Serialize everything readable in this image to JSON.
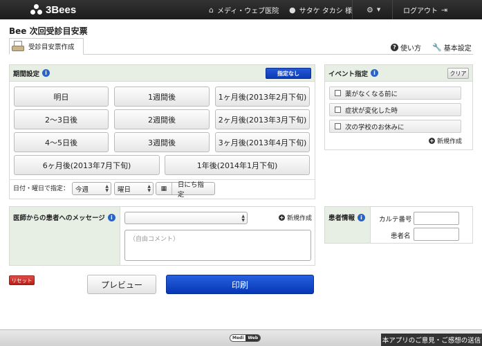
{
  "brand": {
    "name": "3Bees"
  },
  "topnav": {
    "clinic": "メディ・ウェブ医院",
    "user": "サタケ タカシ 様",
    "logout": "ログアウト"
  },
  "page": {
    "title": "Bee 次回受診目安票"
  },
  "tabs": [
    {
      "label": "受診目安票作成"
    }
  ],
  "header_links": {
    "help": "使い方",
    "settings": "基本設定"
  },
  "period": {
    "title": "期間設定",
    "none_button": "指定なし",
    "buttons": [
      "明日",
      "1週間後",
      "1ヶ月後(2013年2月下旬)",
      "2〜3日後",
      "2週間後",
      "2ヶ月後(2013年3月下旬)",
      "4〜5日後",
      "3週間後",
      "3ヶ月後(2013年4月下旬)",
      "6ヶ月後(2013年7月下旬)",
      "1年後(2014年1月下旬)"
    ],
    "date_label": "日付・曜日で指定：",
    "week_select": "今週",
    "day_select": "曜日",
    "date_button": "日にち指定"
  },
  "events": {
    "title": "イベント指定",
    "clear_button": "クリア",
    "items": [
      "薬がなくなる前に",
      "症状が変化した時",
      "次の学校のお休みに"
    ],
    "new_link": "新規作成"
  },
  "message": {
    "title": "医師からの患者へのメッセージ",
    "select_value": "",
    "new_link": "新規作成",
    "comment_placeholder": "（自由コメント）"
  },
  "patient": {
    "title": "患者情報",
    "chart_label": "カルテ番号",
    "name_label": "患者名",
    "chart_value": "",
    "name_value": ""
  },
  "actions": {
    "reset": "リセット",
    "preview": "プレビュー",
    "print": "印刷"
  },
  "footer": {
    "logo_left": "Medi",
    "logo_right": "Web",
    "feedback": "本アプリのご意見・ご感想の送信"
  }
}
